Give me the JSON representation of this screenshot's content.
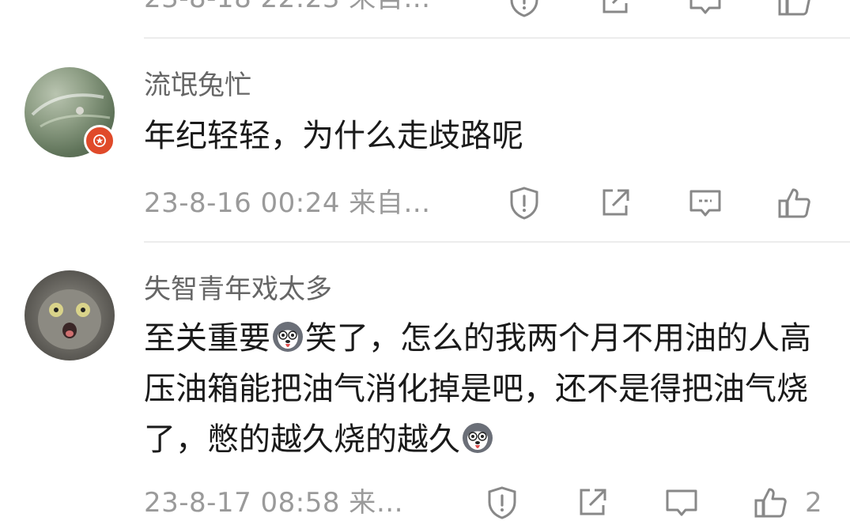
{
  "top_comment": {
    "meta": "23-8-18 22:23 来自…"
  },
  "comments": [
    {
      "username": "流氓兔忙",
      "text": "年纪轻轻，为什么走歧路呢",
      "meta": "23-8-16 00:24 来自…"
    },
    {
      "username": "失智青年戏太多",
      "text_part1": "至关重要",
      "text_part2": "笑了，怎么的我两个月不用油的人高压油箱能把油气消化掉是吧，还不是得把油气烧了，憋的越久烧的越久",
      "meta": "23-8-17 08:58 来…",
      "like_count": "2"
    }
  ],
  "icons": {
    "report": "shield-exclamation-icon",
    "share": "share-box-icon",
    "reply": "comment-bubble-icon",
    "like": "thumbs-up-icon",
    "badge": "star-badge-icon",
    "emoji": "husky-emoji-icon"
  },
  "colors": {
    "text": "#1a1a1a",
    "username": "#666666",
    "meta": "#9a9a9a",
    "badge": "#e04a2a",
    "divider": "#ececec"
  }
}
